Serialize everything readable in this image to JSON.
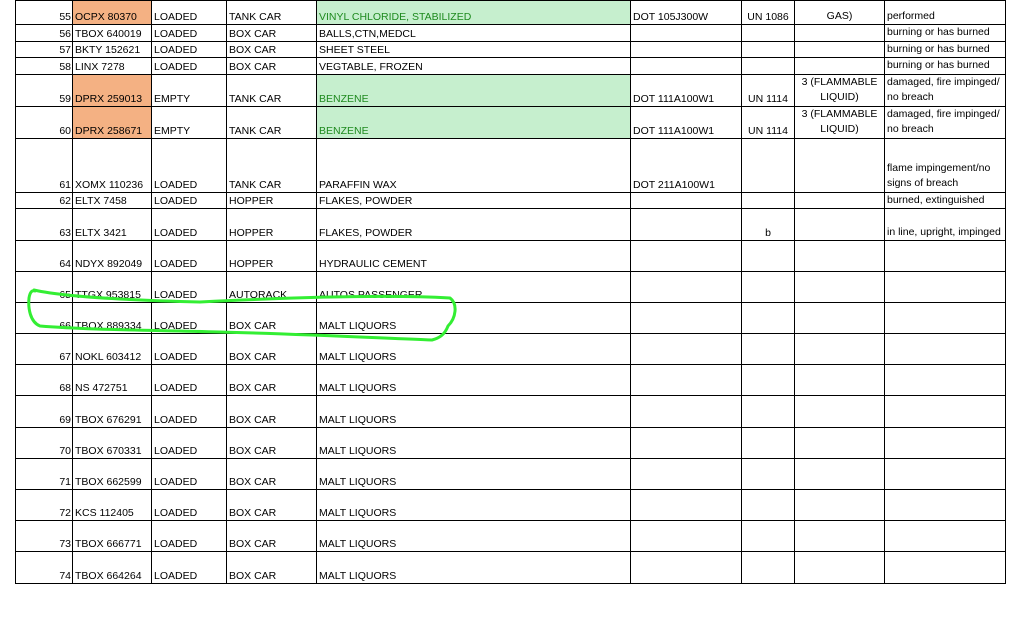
{
  "rows": [
    {
      "num": "55",
      "car": "OCPX 80370",
      "status": "LOADED",
      "type": "TANK CAR",
      "commodity": "VINYL CHLORIDE, STABILIZED",
      "spec": "DOT 105J300W",
      "un": "UN 1086",
      "hazard": "GAS)",
      "notes": "performed",
      "car_highlight": true,
      "commodity_highlight": true
    },
    {
      "num": "56",
      "car": "TBOX 640019",
      "status": "LOADED",
      "type": "BOX CAR",
      "commodity": "BALLS,CTN,MEDCL",
      "spec": "",
      "un": "",
      "hazard": "",
      "notes": "burning or has burned"
    },
    {
      "num": "57",
      "car": "BKTY 152621",
      "status": "LOADED",
      "type": "BOX CAR",
      "commodity": "SHEET STEEL",
      "spec": "",
      "un": "",
      "hazard": "",
      "notes": "burning or has burned"
    },
    {
      "num": "58",
      "car": "LINX 7278",
      "status": "LOADED",
      "type": "BOX CAR",
      "commodity": "VEGTABLE, FROZEN",
      "spec": "",
      "un": "",
      "hazard": "",
      "notes": "burning or has burned"
    },
    {
      "num": "59",
      "car": "DPRX 259013",
      "status": "EMPTY",
      "type": "TANK CAR",
      "commodity": "BENZENE",
      "spec": "DOT 111A100W1",
      "un": "UN 1114",
      "hazard": "3 (FLAMMABLE LIQUID)",
      "notes": "damaged, fire impinged/ no breach",
      "car_highlight": true,
      "commodity_highlight": true
    },
    {
      "num": "60",
      "car": "DPRX 258671",
      "status": "EMPTY",
      "type": "TANK CAR",
      "commodity": "BENZENE",
      "spec": "DOT 111A100W1",
      "un": "UN 1114",
      "hazard": "3 (FLAMMABLE LIQUID)",
      "notes": "damaged, fire impinged/ no breach",
      "car_highlight": true,
      "commodity_highlight": true
    },
    {
      "num": "61",
      "car": "XOMX 110236",
      "status": "LOADED",
      "type": "TANK CAR",
      "commodity": "PARAFFIN WAX",
      "spec": "DOT 211A100W1",
      "un": "",
      "hazard": "",
      "notes": "flame impingement/no signs of breach"
    },
    {
      "num": "62",
      "car": "ELTX 7458",
      "status": "LOADED",
      "type": "HOPPER",
      "commodity": "FLAKES, POWDER",
      "spec": "",
      "un": "",
      "hazard": "",
      "notes": "burned, extinguished"
    },
    {
      "num": "63",
      "car": "ELTX 3421",
      "status": "LOADED",
      "type": "HOPPER",
      "commodity": "FLAKES, POWDER",
      "spec": "",
      "un": "b",
      "hazard": "",
      "notes": "in line, upright, impinged"
    },
    {
      "num": "64",
      "car": "NDYX 892049",
      "status": "LOADED",
      "type": "HOPPER",
      "commodity": "HYDRAULIC CEMENT",
      "spec": "",
      "un": "",
      "hazard": "",
      "notes": ""
    },
    {
      "num": "65",
      "car": "TTGX 953815",
      "status": "LOADED",
      "type": "AUTORACK",
      "commodity": "AUTOS PASSENGER",
      "spec": "",
      "un": "",
      "hazard": "",
      "notes": ""
    },
    {
      "num": "66",
      "car": "TBOX 889334",
      "status": "LOADED",
      "type": "BOX CAR",
      "commodity": "MALT LIQUORS",
      "spec": "",
      "un": "",
      "hazard": "",
      "notes": ""
    },
    {
      "num": "67",
      "car": "NOKL 603412",
      "status": "LOADED",
      "type": "BOX CAR",
      "commodity": "MALT LIQUORS",
      "spec": "",
      "un": "",
      "hazard": "",
      "notes": ""
    },
    {
      "num": "68",
      "car": "NS 472751",
      "status": "LOADED",
      "type": "BOX CAR",
      "commodity": "MALT LIQUORS",
      "spec": "",
      "un": "",
      "hazard": "",
      "notes": ""
    },
    {
      "num": "69",
      "car": "TBOX 676291",
      "status": "LOADED",
      "type": "BOX CAR",
      "commodity": "MALT LIQUORS",
      "spec": "",
      "un": "",
      "hazard": "",
      "notes": ""
    },
    {
      "num": "70",
      "car": "TBOX 670331",
      "status": "LOADED",
      "type": "BOX CAR",
      "commodity": "MALT LIQUORS",
      "spec": "",
      "un": "",
      "hazard": "",
      "notes": ""
    },
    {
      "num": "71",
      "car": "TBOX 662599",
      "status": "LOADED",
      "type": "BOX CAR",
      "commodity": "MALT LIQUORS",
      "spec": "",
      "un": "",
      "hazard": "",
      "notes": ""
    },
    {
      "num": "72",
      "car": "KCS 112405",
      "status": "LOADED",
      "type": "BOX CAR",
      "commodity": "MALT LIQUORS",
      "spec": "",
      "un": "",
      "hazard": "",
      "notes": ""
    },
    {
      "num": "73",
      "car": "TBOX 666771",
      "status": "LOADED",
      "type": "BOX CAR",
      "commodity": "MALT LIQUORS",
      "spec": "",
      "un": "",
      "hazard": "",
      "notes": ""
    },
    {
      "num": "74",
      "car": "TBOX 664264",
      "status": "LOADED",
      "type": "BOX CAR",
      "commodity": "MALT LIQUORS",
      "spec": "",
      "un": "",
      "hazard": "",
      "notes": ""
    }
  ],
  "annotation": {
    "color": "#33ee33",
    "target_row": "65"
  }
}
